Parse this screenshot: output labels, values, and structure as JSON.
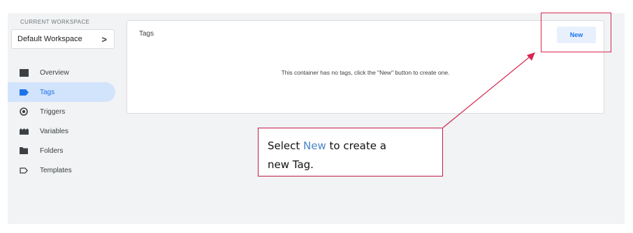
{
  "workspace": {
    "label": "CURRENT WORKSPACE",
    "name": "Default Workspace",
    "chevron": ">"
  },
  "nav": {
    "items": [
      {
        "label": "Overview",
        "icon": "folder-icon",
        "active": false
      },
      {
        "label": "Tags",
        "icon": "tag-icon",
        "active": true
      },
      {
        "label": "Triggers",
        "icon": "trigger-icon",
        "active": false
      },
      {
        "label": "Variables",
        "icon": "variables-icon",
        "active": false
      },
      {
        "label": "Folders",
        "icon": "folder-icon",
        "active": false
      },
      {
        "label": "Templates",
        "icon": "template-icon",
        "active": false
      }
    ]
  },
  "tags_card": {
    "title": "Tags",
    "new_label": "New",
    "empty_message": "This container has no tags, click the \"New\" button to create one."
  },
  "callout": {
    "text_before": "Select ",
    "highlight": "New",
    "text_after": " to create a",
    "line2": "new Tag."
  },
  "colors": {
    "accent": "#1a73e8",
    "annotation": "#d6264f",
    "active_nav_bg": "#d2e3fc"
  }
}
